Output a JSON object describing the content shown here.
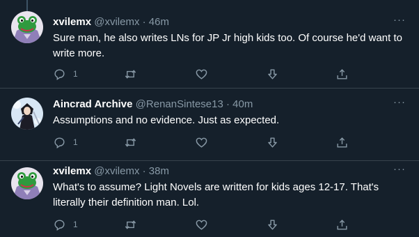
{
  "tweets": [
    {
      "name": "xvilemx",
      "handle": "@xvilemx",
      "dot": "·",
      "time": "46m",
      "text": "Sure man, he also writes LNs for JP Jr high kids too. Of course he'd want to write more.",
      "reply_count": "1",
      "more": "···"
    },
    {
      "name": "Aincrad Archive",
      "handle": "@RenanSintese13",
      "dot": "·",
      "time": "40m",
      "text": "Assumptions and no evidence. Just as expected.",
      "reply_count": "1",
      "more": "···"
    },
    {
      "name": "xvilemx",
      "handle": "@xvilemx",
      "dot": "·",
      "time": "38m",
      "text": "What's to assume? Light Novels are written for kids ages 12-17. That's literally their definition man. Lol.",
      "reply_count": "1",
      "more": "···"
    }
  ],
  "icons": {
    "reply": "reply-icon",
    "retweet": "retweet-icon",
    "like": "heart-icon",
    "dislike": "down-arrow-icon",
    "share": "share-icon",
    "more": "more-icon"
  },
  "colors": {
    "background": "#15202b",
    "primary_text": "#ffffff",
    "secondary_text": "#8899a6",
    "divider": "#38444d",
    "thread_line": "#3d5466"
  }
}
